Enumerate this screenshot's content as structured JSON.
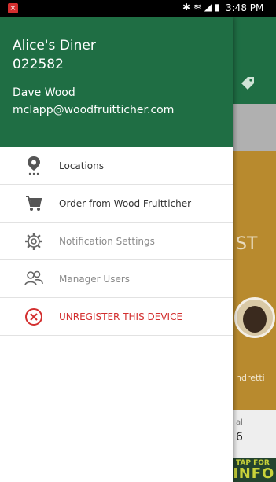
{
  "status_bar": {
    "time": "3:48 PM",
    "icons": "✱ ≋ ◢ ▮"
  },
  "drawer": {
    "header": {
      "business_name": "Alice's Diner",
      "business_id": "022582",
      "user_name": "Dave Wood",
      "user_email": "mclapp@woodfruitticher.com",
      "background_color": "#1f6e44"
    },
    "menu_items": [
      {
        "label": "Locations",
        "icon": "map-pin-icon"
      },
      {
        "label": "Order from Wood Fruitticher",
        "icon": "shopping-cart-icon"
      },
      {
        "label": "Notification Settings",
        "icon": "gear-icon"
      },
      {
        "label": "Manager Users",
        "icon": "users-icon"
      },
      {
        "label": "UNREGISTER THIS DEVICE",
        "icon": "close-circle-icon"
      }
    ]
  },
  "background": {
    "partial_text_st": "ST",
    "partial_name": "ndretti",
    "partial_label": "al",
    "partial_value": "6",
    "footer_tap": "TAP FOR",
    "footer_info": "INFO"
  },
  "colors": {
    "accent_green": "#1f6e44",
    "danger_red": "#d32f2f",
    "gold": "#b88a2e"
  }
}
